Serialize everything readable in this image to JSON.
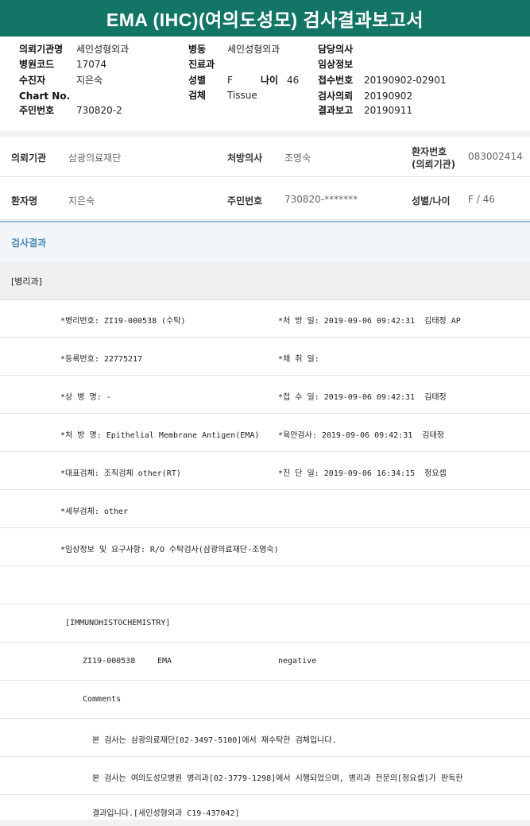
{
  "title": "EMA (IHC)(여의도성모) 검사결과보고서",
  "header": {
    "left": [
      {
        "label": "의뢰기관명",
        "value": "세인성형외과"
      },
      {
        "label": "병원코드",
        "value": "17074"
      },
      {
        "label": "수진자",
        "value": "지은숙"
      },
      {
        "label": "Chart No.",
        "value": ""
      },
      {
        "label": "주민번호",
        "value": "730820-2"
      }
    ],
    "mid": [
      {
        "label": "병동",
        "value": "세인성형외과"
      },
      {
        "label": "진료과",
        "value": ""
      },
      {
        "label": "성별",
        "value": "F"
      },
      {
        "label": "검체",
        "value": "Tissue"
      }
    ],
    "age": {
      "label": "나이",
      "value": "46"
    },
    "right": [
      {
        "label": "담당의사",
        "value": ""
      },
      {
        "label": "임상정보",
        "value": ""
      },
      {
        "label": "접수번호",
        "value": "20190902-02901"
      },
      {
        "label": "검사의뢰",
        "value": "20190902"
      },
      {
        "label": "결과보고",
        "value": "20190911"
      }
    ]
  },
  "info": {
    "row1": {
      "org_label": "의뢰기관",
      "org_value": "삼광의료재단",
      "doctor_label": "처방의사",
      "doctor_value": "조영숙",
      "pid_label_1": "환자번호",
      "pid_label_2": "(의뢰기관)",
      "pid_value": "083002414"
    },
    "row2": {
      "name_label": "환자명",
      "name_value": "지은숙",
      "rrn_label": "주민번호",
      "rrn_value": "730820-*******",
      "sexage_label": "성별/나이",
      "sexage_value": "F / 46"
    }
  },
  "result_title": "검사결과",
  "dept": "[병리과]",
  "report": {
    "l1a": "*병리번호: ZI19-000538 (수탁)",
    "l1b": "*처 방 일: 2019-09-06 09:42:31  김태정 AP",
    "l2a": "*등록번호: 22775217",
    "l2b": "*채 취 일:",
    "l3a": "*상 병 명: -",
    "l3b": "*접 수 일: 2019-09-06 09:42:31  김태정",
    "l4a": "*처 방 명: Epithelial Membrane Antigen(EMA)",
    "l4b": "*육안검사: 2019-09-06 09:42:31  김태정",
    "l5a": "*대표검체: 조직검체 other(RT)",
    "l5b": "*진 단 일: 2019-09-06 16:34:15  정요셉",
    "l6a": "*세부검체: other",
    "l7a": "*임상정보 및 요구사항: R/O 수탁검사(삼광의료재단-조영숙)",
    "ihc": "[IMMUNOHISTOCHEMISTRY]",
    "ihc_id": "ZI19-000538",
    "ihc_marker": "EMA",
    "ihc_result": "negative",
    "comments": "Comments",
    "c1": "본 검사는 삼광의료재단[02-3497-5100]에서 재수탁한 검체입니다.",
    "c2": "본 검사는 여의도성모병원 병리과[02-3779-1298]에서 시행되었으며, 병리과 전문의[정요셉]가 판독한",
    "c3": "결과입니다.[세인성형외과 C19-437042]"
  }
}
